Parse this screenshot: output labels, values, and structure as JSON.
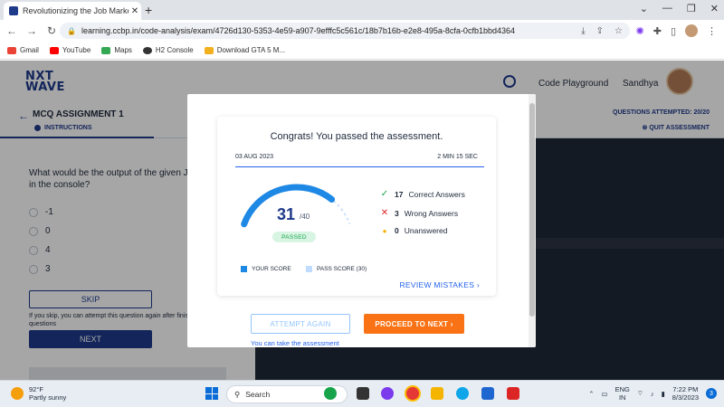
{
  "browser": {
    "tab_title": "Revolutionizing the Job Market |",
    "tab_close": "✕",
    "new_tab": "+",
    "url": "learning.ccbp.in/code-analysis/exam/4726d130-5353-4e59-a907-9efffc5c561c/18b7b16b-e2e8-495a-8cfa-0cfb1bbd4364",
    "bookmarks": [
      {
        "label": "Gmail",
        "color": "#ea4335"
      },
      {
        "label": "YouTube",
        "color": "#ff0000"
      },
      {
        "label": "Maps",
        "color": "#34a853"
      },
      {
        "label": "H2 Console",
        "color": "#333333"
      },
      {
        "label": "Download GTA 5 M...",
        "color": "#f2b01e"
      }
    ]
  },
  "page": {
    "logo_line1": "NXT",
    "logo_line2": "WAVE",
    "code_playground": "Code Playground",
    "user_name": "Sandhya",
    "assignment_title": "MCQ ASSIGNMENT 1",
    "instructions": "INSTRUCTIONS",
    "questions_attempted": "QUESTIONS ATTEMPTED: 20/20",
    "quit_exam": "QUIT ASSESSMENT",
    "question": "What would be the output of the given JavaScript code in the console?",
    "options": [
      "-1",
      "0",
      "4",
      "3"
    ],
    "skip_label": "SKIP",
    "skip_note": "If you skip, you can attempt this question again after finishing all questions",
    "next_label": "NEXT"
  },
  "modal": {
    "congrats": "Congrats! You passed the assessment.",
    "date": "03 AUG 2023",
    "duration": "2 MIN 15 SEC",
    "score": "31",
    "score_total": "/40",
    "passed_label": "PASSED",
    "score_fraction": 0.775,
    "pass_fraction": 0.75,
    "correct_count": "17",
    "correct_label": "Correct Answers",
    "wrong_count": "3",
    "wrong_label": "Wrong Answers",
    "unanswered_count": "0",
    "unanswered_label": "Unanswered",
    "legend_score": "YOUR SCORE",
    "legend_pass": "PASS SCORE (30)",
    "review_label": "REVIEW MISTAKES",
    "attempt_again": "ATTEMPT AGAIN",
    "proceed_next": "PROCEED TO NEXT",
    "can_take_note": "You can take the assessment",
    "colors": {
      "score": "#1e88e5",
      "pass": "#bfdbfe",
      "correct": "#16a34a",
      "wrong": "#dc2626",
      "unanswered": "#f5b400",
      "proceed": "#f97316"
    }
  },
  "taskbar": {
    "temperature": "92°F",
    "weather": "Partly sunny",
    "search": "Search",
    "lang_line1": "ENG",
    "lang_line2": "IN",
    "time": "7:22 PM",
    "date": "8/3/2023",
    "notifications": "3"
  }
}
